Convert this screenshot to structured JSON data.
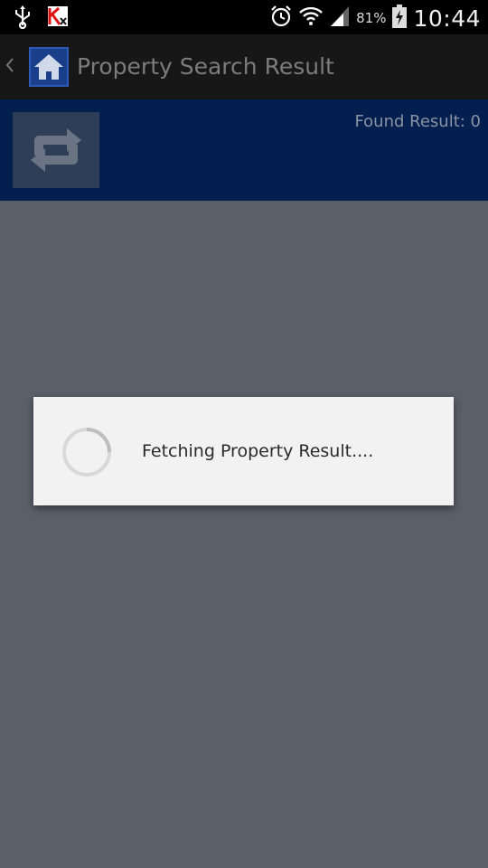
{
  "status_bar": {
    "icons_left": [
      "usb-icon",
      "antivirus-icon"
    ],
    "icons_right": [
      "alarm-icon",
      "wifi-icon",
      "signal-icon",
      "battery-charging-icon"
    ],
    "battery_percent": "81%",
    "time": "10:44"
  },
  "action_bar": {
    "title": "Property Search Result",
    "home_icon": "home-icon",
    "back_icon": "chevron-left-icon"
  },
  "toolbar": {
    "found_result": "Found Result: 0",
    "refresh_icon": "refresh-icon"
  },
  "dialog": {
    "message": "Fetching Property Result....",
    "spinner_icon": "loading-spinner-icon"
  },
  "colors": {
    "status_bar_bg": "#000000",
    "action_bar_bg": "#171717",
    "band_bg": "#031f4f",
    "dim_overlay_bg": "#5a5f69",
    "dialog_bg": "#f2f2f2"
  }
}
